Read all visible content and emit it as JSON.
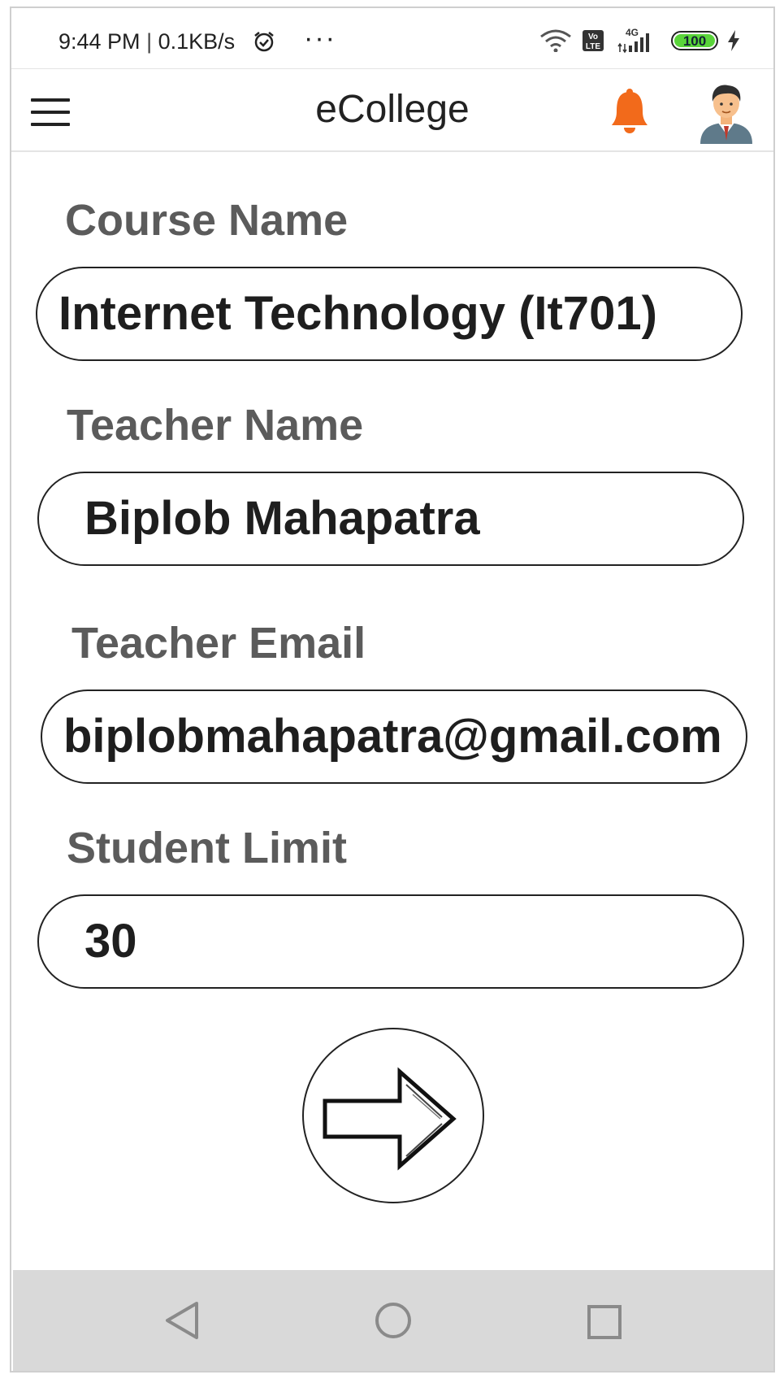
{
  "status_bar": {
    "time": "9:44 PM",
    "separator": "|",
    "network_speed": "0.1KB/s",
    "more_dots": "···",
    "network_type": "4G",
    "volte": "Vo LTE",
    "battery_level": "100",
    "icons": [
      "alarm-icon",
      "wifi-icon",
      "volte-icon",
      "signal-icon",
      "battery-icon",
      "charging-icon"
    ]
  },
  "app_bar": {
    "title": "eCollege",
    "icons": [
      "hamburger-menu-icon",
      "notification-bell-icon",
      "user-avatar-icon"
    ],
    "bell_color": "#f26a1b"
  },
  "form": {
    "course_name_label": "Course Name",
    "course_name_value": "Internet Technology (It701)",
    "teacher_name_label": "Teacher Name",
    "teacher_name_value": "Biplob Mahapatra",
    "teacher_email_label": "Teacher Email",
    "teacher_email_value": "biplobmahapatra@gmail.com",
    "student_limit_label": "Student Limit",
    "student_limit_value": "30",
    "next_icon": "arrow-right-icon"
  },
  "nav_bar": {
    "icons": [
      "back-triangle-icon",
      "home-circle-icon",
      "recents-square-icon"
    ],
    "background": "#d9d9d9"
  }
}
